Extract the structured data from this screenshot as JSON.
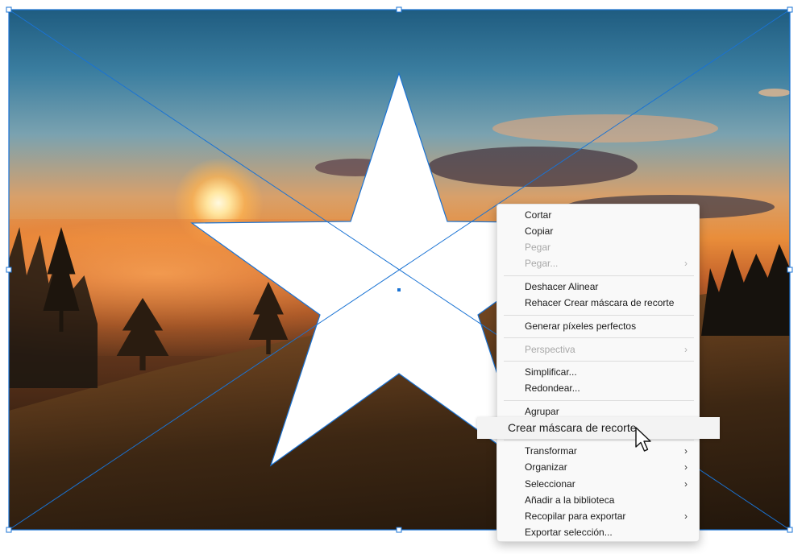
{
  "menu": {
    "items": [
      {
        "label": "Cortar",
        "enabled": true,
        "submenu": false
      },
      {
        "label": "Copiar",
        "enabled": true,
        "submenu": false
      },
      {
        "label": "Pegar",
        "enabled": false,
        "submenu": false
      },
      {
        "label": "Pegar...",
        "enabled": false,
        "submenu": true
      },
      {
        "label": "Deshacer Alinear",
        "enabled": true,
        "submenu": false
      },
      {
        "label": "Rehacer Crear máscara de recorte",
        "enabled": true,
        "submenu": false
      },
      {
        "label": "Generar píxeles perfectos",
        "enabled": true,
        "submenu": false
      },
      {
        "label": "Perspectiva",
        "enabled": false,
        "submenu": true
      },
      {
        "label": "Simplificar...",
        "enabled": true,
        "submenu": false
      },
      {
        "label": "Redondear...",
        "enabled": true,
        "submenu": false
      },
      {
        "label": "Agrupar",
        "enabled": true,
        "submenu": false
      },
      {
        "label": "Crear máscara de recorte",
        "enabled": true,
        "submenu": false,
        "highlighted": true
      },
      {
        "label": "Transformar",
        "enabled": true,
        "submenu": true
      },
      {
        "label": "Organizar",
        "enabled": true,
        "submenu": true
      },
      {
        "label": "Seleccionar",
        "enabled": true,
        "submenu": true
      },
      {
        "label": "Añadir a la biblioteca",
        "enabled": true,
        "submenu": false
      },
      {
        "label": "Recopilar para exportar",
        "enabled": true,
        "submenu": true
      },
      {
        "label": "Exportar selección...",
        "enabled": true,
        "submenu": false
      }
    ],
    "chevron": "›"
  },
  "colors": {
    "selection": "#1a73d4",
    "star_fill": "#ffffff",
    "menu_bg": "#f9f9f9"
  },
  "icons": [
    "arrow-cursor-icon",
    "chevron-right-icon"
  ]
}
